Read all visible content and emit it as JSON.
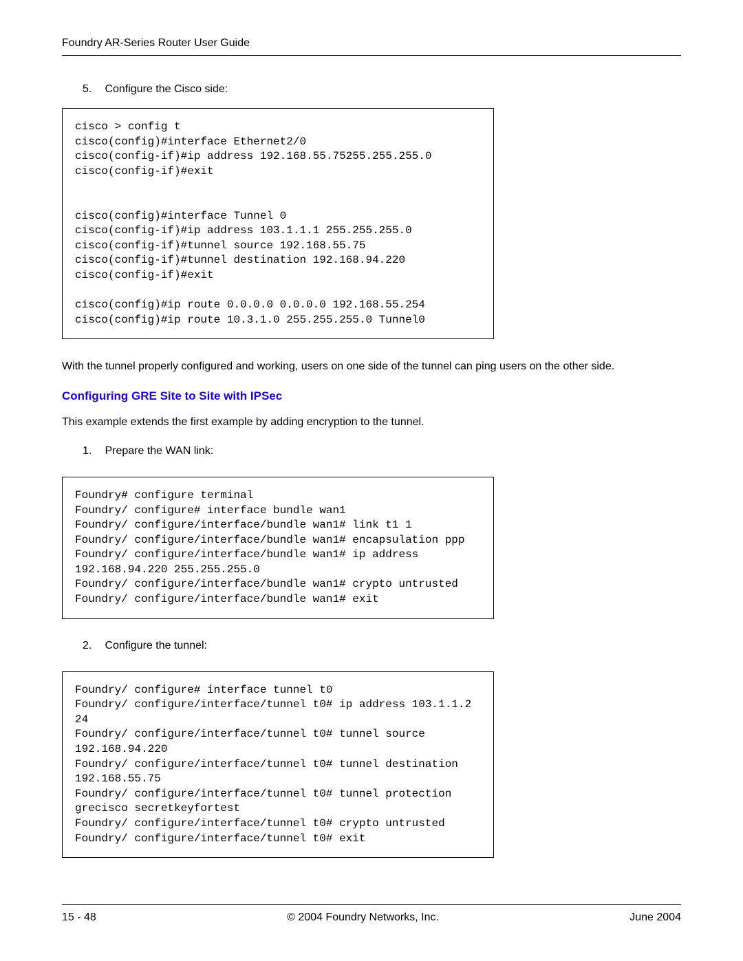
{
  "header": {
    "title": "Foundry AR-Series Router User Guide"
  },
  "step5": {
    "num": "5.",
    "text": "Configure the Cisco side:"
  },
  "code1": {
    "content": "cisco > config t\ncisco(config)#interface Ethernet2/0\ncisco(config-if)#ip address 192.168.55.75255.255.255.0\ncisco(config-if)#exit\n\n\ncisco(config)#interface Tunnel 0\ncisco(config-if)#ip address 103.1.1.1 255.255.255.0\ncisco(config-if)#tunnel source 192.168.55.75\ncisco(config-if)#tunnel destination 192.168.94.220\ncisco(config-if)#exit\n\ncisco(config)#ip route 0.0.0.0 0.0.0.0 192.168.55.254\ncisco(config)#ip route 10.3.1.0 255.255.255.0 Tunnel0"
  },
  "para1": {
    "text": "With the tunnel properly configured and working, users on one side of the tunnel can ping users on the other side."
  },
  "heading1": {
    "text": "Configuring GRE Site to Site with IPSec"
  },
  "para2": {
    "text": "This example extends the first example by adding encryption to the tunnel."
  },
  "step1": {
    "num": "1.",
    "text": "Prepare the WAN link:"
  },
  "code2": {
    "content": "Foundry# configure terminal\nFoundry/ configure# interface bundle wan1\nFoundry/ configure/interface/bundle wan1# link t1 1\nFoundry/ configure/interface/bundle wan1# encapsulation ppp\nFoundry/ configure/interface/bundle wan1# ip address 192.168.94.220 255.255.255.0\nFoundry/ configure/interface/bundle wan1# crypto untrusted\nFoundry/ configure/interface/bundle wan1# exit"
  },
  "step2": {
    "num": "2.",
    "text": "Configure the tunnel:"
  },
  "code3": {
    "content": "Foundry/ configure# interface tunnel t0\nFoundry/ configure/interface/tunnel t0# ip address 103.1.1.2 24\nFoundry/ configure/interface/tunnel t0# tunnel source 192.168.94.220\nFoundry/ configure/interface/tunnel t0# tunnel destination 192.168.55.75\nFoundry/ configure/interface/tunnel t0# tunnel protection grecisco secretkeyfortest\nFoundry/ configure/interface/tunnel t0# crypto untrusted\nFoundry/ configure/interface/tunnel t0# exit"
  },
  "footer": {
    "page": "15 - 48",
    "copyright": "© 2004 Foundry Networks, Inc.",
    "date": "June 2004"
  }
}
